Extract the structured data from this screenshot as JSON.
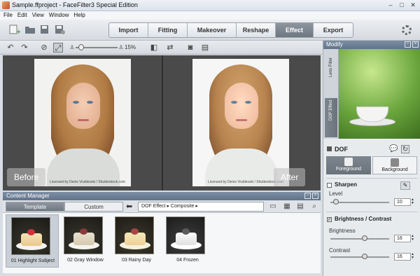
{
  "window": {
    "title": "Sample.ffproject - FaceFilter3 Special Edition",
    "controls": [
      "–",
      "□",
      "✕"
    ]
  },
  "menu": [
    "File",
    "Edit",
    "View",
    "Window",
    "Help"
  ],
  "main_tabs": [
    {
      "label": "Import",
      "active": false
    },
    {
      "label": "Fitting",
      "active": false
    },
    {
      "label": "Makeover",
      "active": false
    },
    {
      "label": "Reshape",
      "active": false
    },
    {
      "label": "Effect",
      "active": true
    },
    {
      "label": "Export",
      "active": false
    }
  ],
  "toolbar": {
    "zoom": "15%"
  },
  "preview": {
    "before_label": "Before",
    "after_label": "After",
    "credit_left": "Licensed by Denis Vrublevski / Shutterstock.com",
    "credit_right": "Licensed by Denis Vrublevski / Shutterstock.com"
  },
  "content_manager": {
    "title": "Content Manager",
    "tabs": [
      {
        "label": "Template",
        "active": true
      },
      {
        "label": "Custom",
        "active": false
      }
    ],
    "path": [
      "DOF Effect",
      "Composite"
    ],
    "thumbnails": [
      {
        "label": "01 Highlight Subject",
        "selected": true
      },
      {
        "label": "02 Gray Window",
        "selected": false
      },
      {
        "label": "03 Rainy Day",
        "selected": false
      },
      {
        "label": "04 Frozen",
        "selected": false
      }
    ]
  },
  "modify": {
    "title": "Modify",
    "side_tabs": [
      {
        "label": "Lens Filter",
        "active": false
      },
      {
        "label": "DOF Effect",
        "active": true
      }
    ],
    "section_title": "DOF",
    "fg_label": "Foreground",
    "bg_label": "Background",
    "sharpen": {
      "title": "Sharpen",
      "checked": false,
      "level_label": "Level",
      "level_value": "10",
      "level_fraction": 0.1
    },
    "brightness_contrast": {
      "title": "Brightness / Contrast",
      "checked": true,
      "brightness_label": "Brightness",
      "brightness_value": "16",
      "brightness_fraction": 0.58,
      "contrast_label": "Contrast",
      "contrast_value": "16",
      "contrast_fraction": 0.58
    }
  }
}
